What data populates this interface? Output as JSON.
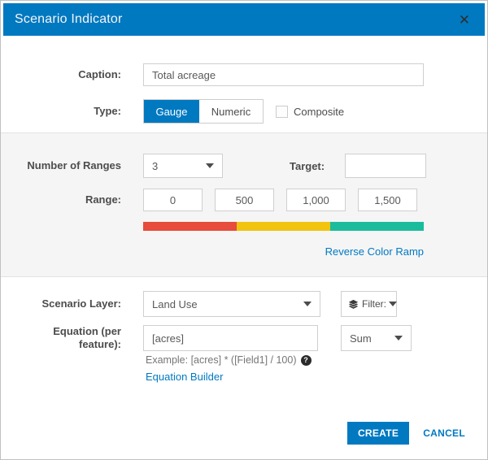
{
  "colors": {
    "accent": "#0079c1",
    "ramp": [
      "#e74c3c",
      "#f1c40f",
      "#1abc9c"
    ]
  },
  "header": {
    "title": "Scenario Indicator",
    "close_icon": "✕"
  },
  "caption_row": {
    "label": "Caption:",
    "value": "Total acreage"
  },
  "type_row": {
    "label": "Type:",
    "options": [
      {
        "label": "Gauge",
        "selected": true
      },
      {
        "label": "Numeric",
        "selected": false
      }
    ],
    "composite_label": "Composite",
    "composite_checked": false
  },
  "ranges_section": {
    "number_of_ranges_label": "Number of Ranges",
    "number_of_ranges_value": "3",
    "target_label": "Target:",
    "target_value": "",
    "range_label": "Range:",
    "range_values": [
      "0",
      "500",
      "1,000",
      "1,500"
    ],
    "reverse_link": "Reverse Color Ramp"
  },
  "layer_row": {
    "label": "Scenario Layer:",
    "value": "Land Use",
    "filter_label": "Filter:"
  },
  "equation_row": {
    "label": "Equation (per feature):",
    "value": "[acres]",
    "aggregate_value": "Sum",
    "example": "Example: [acres] * ([Field1] / 100)",
    "help_glyph": "?",
    "builder_link": "Equation Builder"
  },
  "footer": {
    "create": "CREATE",
    "cancel": "CANCEL"
  }
}
